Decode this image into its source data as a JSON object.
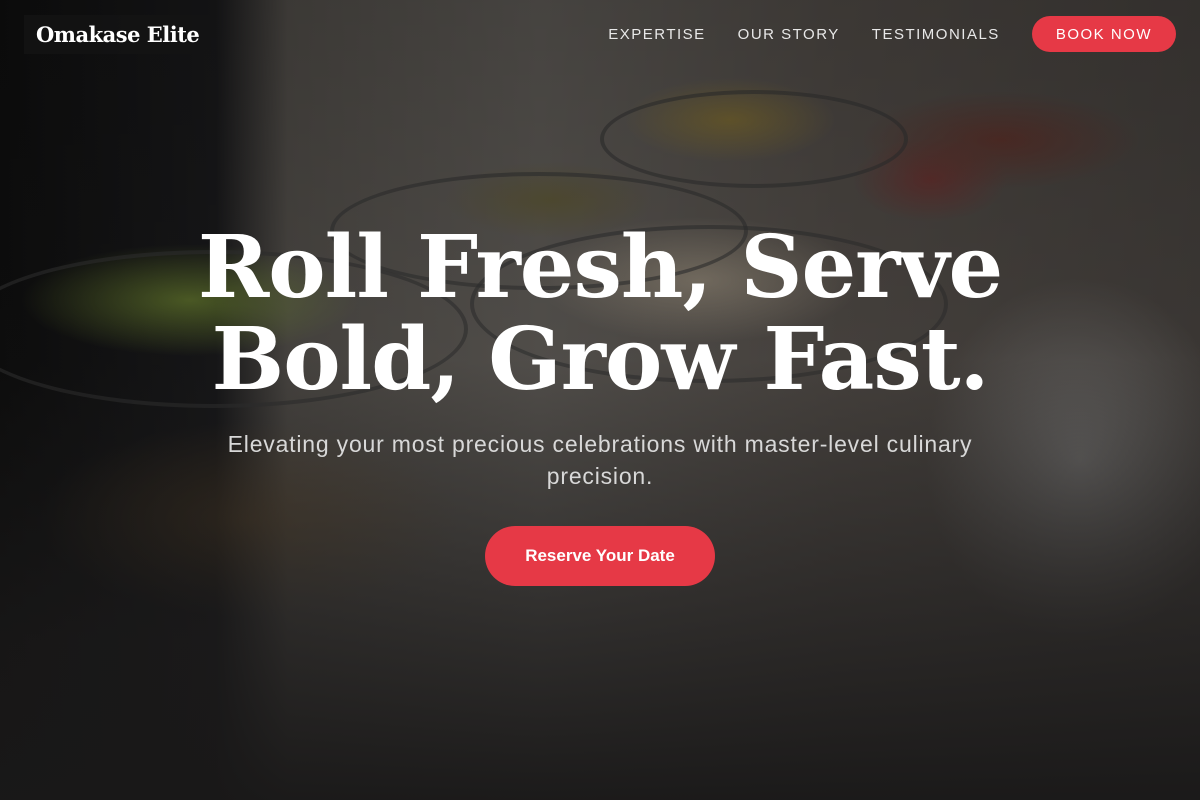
{
  "brand": {
    "logo_text": "Omakase Elite"
  },
  "nav": {
    "links": [
      "EXPERTISE",
      "OUR STORY",
      "TESTIMONIALS"
    ],
    "book_label": "BOOK NOW"
  },
  "hero": {
    "headline_line1": "Roll Fresh, Serve",
    "headline_line2": "Bold, Grow Fast.",
    "subheading": "Elevating your most precious celebrations with master-level culinary precision.",
    "cta_label": "Reserve Your Date"
  },
  "colors": {
    "accent": "#e63946",
    "text": "#ffffff",
    "background_dark": "#1a1818"
  }
}
